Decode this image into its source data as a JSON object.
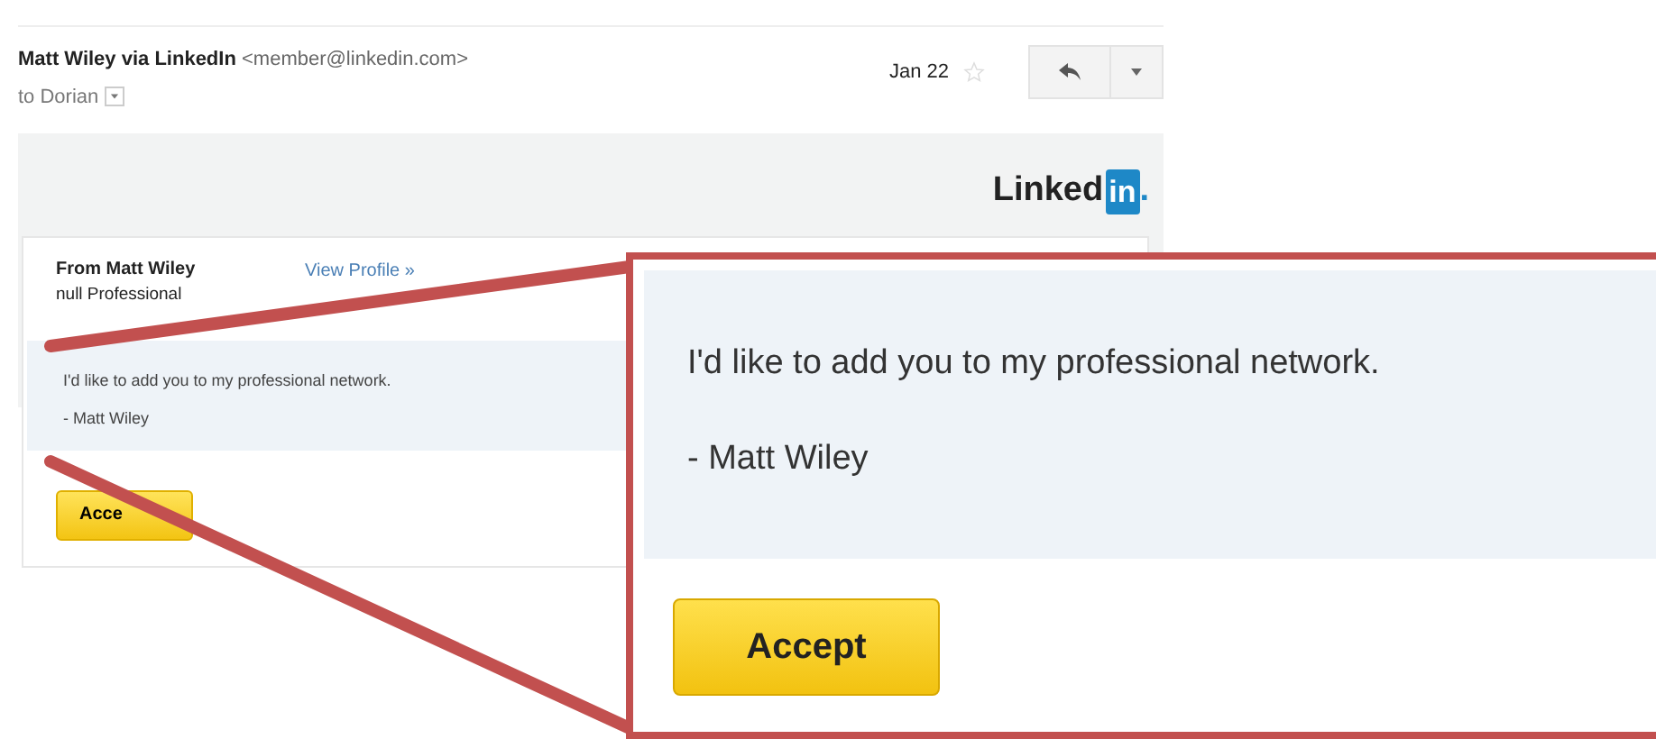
{
  "email": {
    "sender": "Matt Wiley via LinkedIn",
    "address": "<member@linkedin.com>",
    "recipient": "to Dorian",
    "date": "Jan 22",
    "starred": false
  },
  "logo": {
    "word": "Linked",
    "badge": "in",
    "dot": "."
  },
  "card": {
    "from": "From Matt Wiley",
    "headline": "null Professional",
    "link": "View Profile »",
    "message": "I'd like to add you to my professional network.",
    "signature": "- Matt Wiley",
    "button": "Acce"
  },
  "callout": {
    "message": "I'd like to add you to my professional network.",
    "signature": "- Matt Wiley",
    "button": "Accept"
  }
}
